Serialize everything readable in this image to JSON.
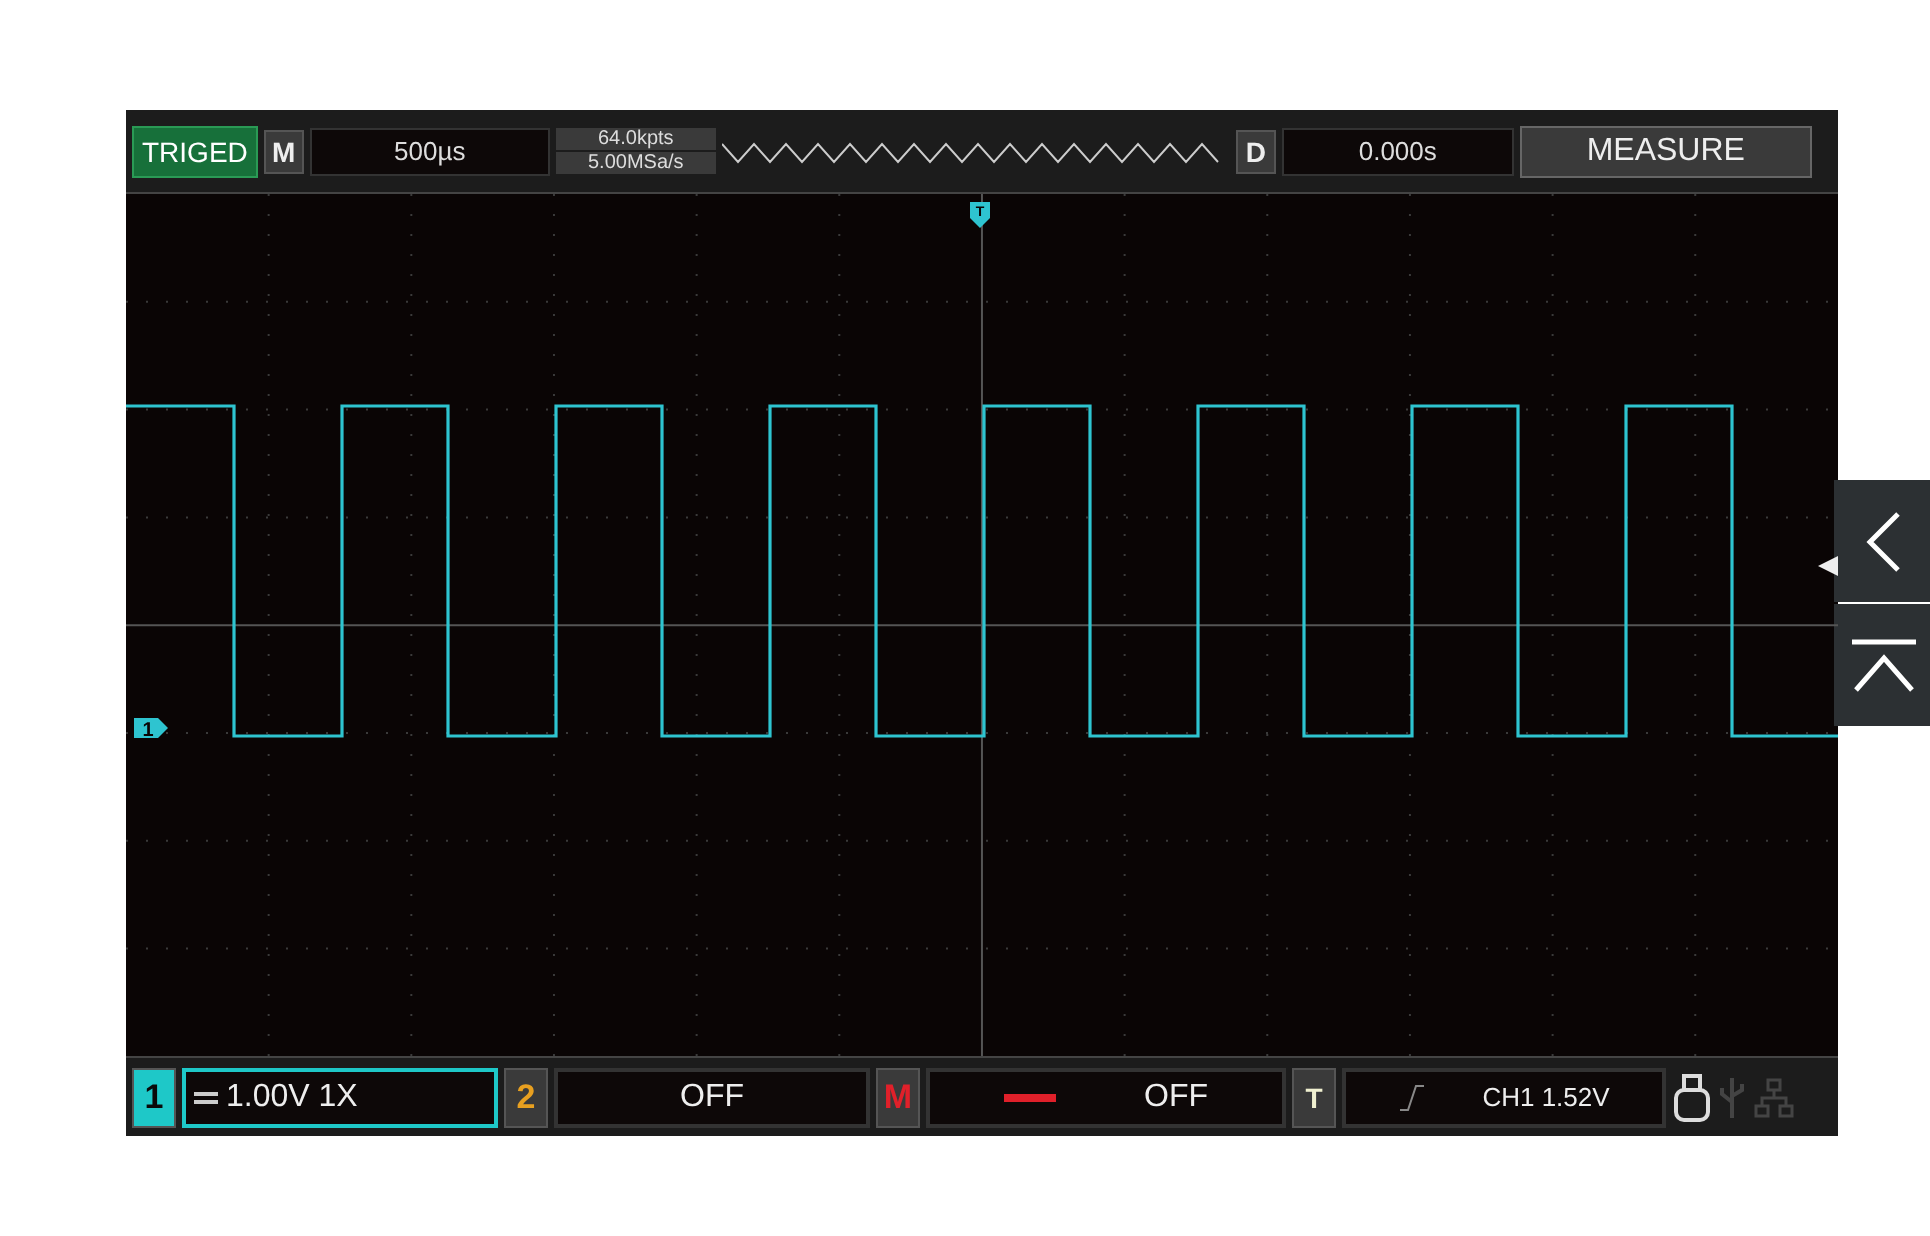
{
  "top_bar": {
    "trigger_status": "TRIGED",
    "mode_badge": "M",
    "timebase": "500µs",
    "memory_depth": "64.0kpts",
    "sample_rate": "5.00MSa/s",
    "delay_badge": "D",
    "delay": "0.000s",
    "menu_button": "MEASURE"
  },
  "markers": {
    "trigger_position": "T",
    "channel_1": "1"
  },
  "bottom_bar": {
    "channels": [
      {
        "kind": "channel",
        "number": "1",
        "setting": "1.00V 1X",
        "selected": true,
        "color": "#1ec8c8"
      },
      {
        "kind": "channel",
        "number": "2",
        "setting": "OFF",
        "selected": false,
        "color": "#e8a020"
      },
      {
        "kind": "math",
        "number": "M",
        "setting": "OFF",
        "selected": false,
        "color": "#e0202a"
      }
    ],
    "trigger": {
      "badge": "T",
      "source": "CH1 1.52V"
    }
  }
}
